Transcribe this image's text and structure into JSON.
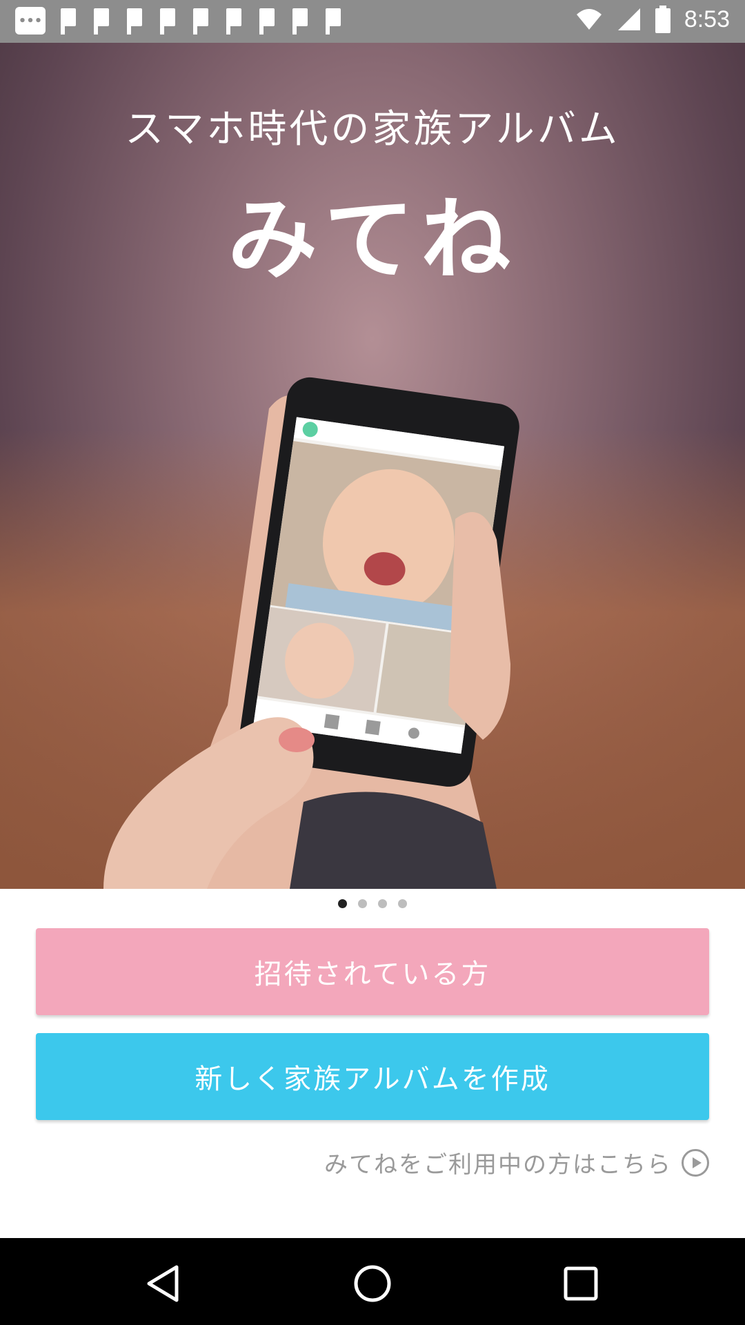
{
  "status_bar": {
    "time": "8:53",
    "notification_icons": [
      "more-icon",
      "flag-icon",
      "flag-icon",
      "flag-icon",
      "flag-icon",
      "flag-icon",
      "flag-icon",
      "flag-icon",
      "flag-icon",
      "flag-icon"
    ],
    "right_icons": [
      "wifi-icon",
      "signal-icon",
      "battery-icon"
    ]
  },
  "hero": {
    "tagline": "スマホ時代の家族アルバム",
    "logo": "みてね"
  },
  "pager": {
    "count": 4,
    "active_index": 0
  },
  "buttons": {
    "invited": "招待されている方",
    "create": "新しく家族アルバムを作成"
  },
  "existing_user_link": "みてねをご利用中の方はこちら",
  "colors": {
    "invited_button": "#f3a7bb",
    "create_button": "#3cc8ec",
    "status_bar": "#8d8d8d",
    "nav_bar": "#000000"
  },
  "nav_bar": [
    "back-icon",
    "home-icon",
    "recent-apps-icon"
  ]
}
